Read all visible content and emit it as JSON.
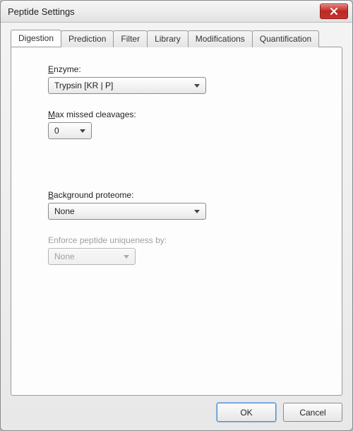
{
  "window": {
    "title": "Peptide Settings"
  },
  "tabs": [
    {
      "label": "Digestion"
    },
    {
      "label": "Prediction"
    },
    {
      "label": "Filter"
    },
    {
      "label": "Library"
    },
    {
      "label": "Modifications"
    },
    {
      "label": "Quantification"
    }
  ],
  "digestion": {
    "enzyme_label_pre": "",
    "enzyme_label_mn": "E",
    "enzyme_label_post": "nzyme:",
    "enzyme_value": "Trypsin [KR | P]",
    "missed_label_pre": "",
    "missed_label_mn": "M",
    "missed_label_post": "ax missed cleavages:",
    "missed_value": "0",
    "bg_label_pre": "",
    "bg_label_mn": "B",
    "bg_label_post": "ackground proteome:",
    "bg_value": "None",
    "enforce_label": "Enforce peptide uniqueness by:",
    "enforce_value": "None"
  },
  "buttons": {
    "ok": "OK",
    "cancel": "Cancel"
  }
}
